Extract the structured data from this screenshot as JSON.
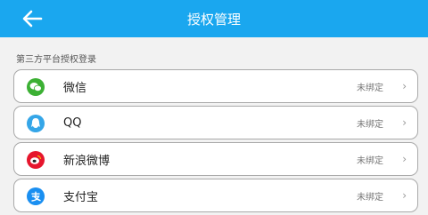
{
  "header": {
    "title": "授权管理",
    "back_icon": "arrow-left-icon",
    "background_color": "#1aa7ef"
  },
  "section": {
    "label": "第三方平台授权登录"
  },
  "platforms": [
    {
      "name": "微信",
      "status": "未绑定",
      "icon": "wechat-icon",
      "color": "#3cb034"
    },
    {
      "name": "QQ",
      "status": "未绑定",
      "icon": "qq-icon",
      "color": "#35a6e8"
    },
    {
      "name": "新浪微博",
      "status": "未绑定",
      "icon": "weibo-icon",
      "color": "#e6162d"
    },
    {
      "name": "支付宝",
      "status": "未绑定",
      "icon": "alipay-icon",
      "color": "#1a8ff1"
    }
  ],
  "chevron_glyph": "›"
}
